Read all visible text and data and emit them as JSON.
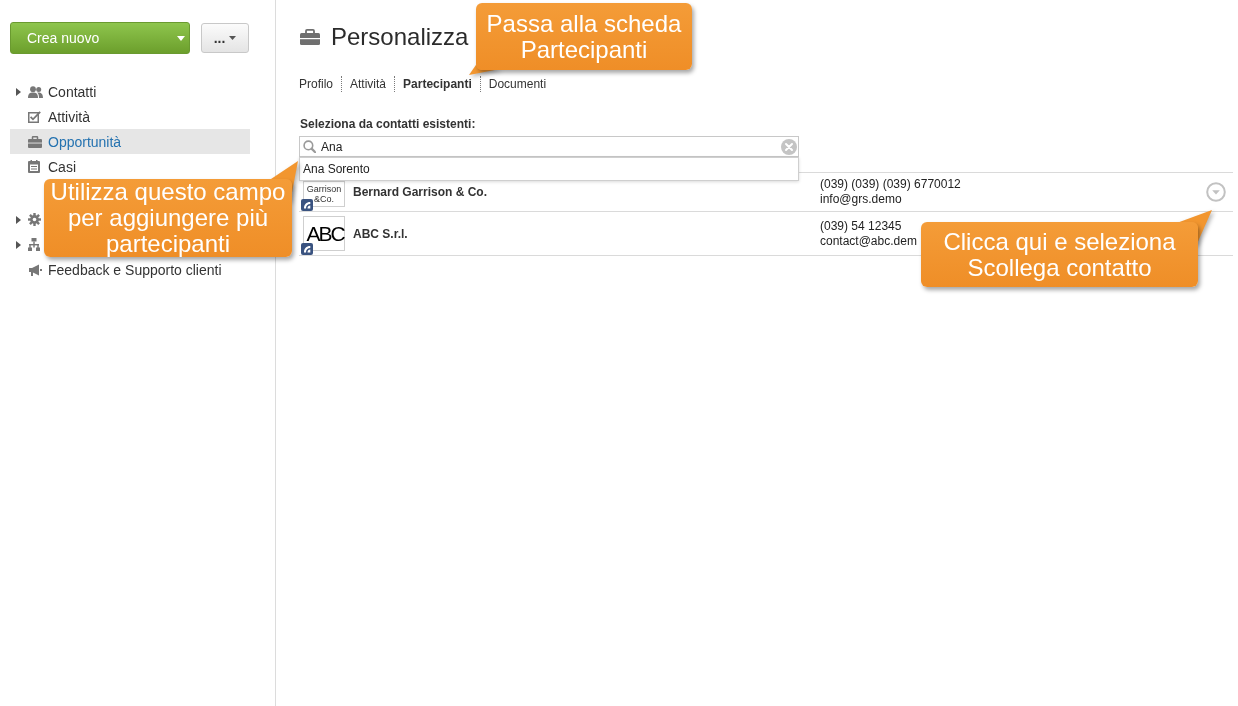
{
  "sidebar": {
    "create_button": {
      "label": "Crea nuovo"
    },
    "more_button": {
      "label": "..."
    },
    "groups": [
      {
        "items": [
          {
            "label": "Contatti",
            "expandable": true,
            "selected": false
          },
          {
            "label": "Attività",
            "expandable": false,
            "selected": false
          },
          {
            "label": "Opportunità",
            "expandable": false,
            "selected": true
          },
          {
            "label": "Casi",
            "expandable": false,
            "selected": false
          }
        ]
      },
      {
        "items": [
          {
            "expandable": true,
            "selected": false
          },
          {
            "expandable": true,
            "selected": false
          },
          {
            "label": "Feedback e Supporto clienti",
            "expandable": false,
            "selected": false
          }
        ]
      }
    ]
  },
  "page": {
    "title": "Personalizza"
  },
  "tabs": [
    {
      "label": "Profilo",
      "selected": false
    },
    {
      "label": "Attività",
      "selected": false
    },
    {
      "label": "Partecipanti",
      "selected": true
    },
    {
      "label": "Documenti",
      "selected": false
    }
  ],
  "participants": {
    "label": "Seleziona da contatti esistenti:",
    "search": {
      "value": "Ana"
    },
    "suggestions": [
      "Ana Sorento"
    ],
    "rows": [
      {
        "logo_text": "Garrison &Co.",
        "name": "Bernard Garrison & Co.",
        "phone": "(039) (039) (039) 6770012",
        "email": "info@grs.demo",
        "hovered": true
      },
      {
        "logo_text": "ABC",
        "name": "ABC S.r.l.",
        "phone": "(039) 54 12345",
        "email": "contact@abc.dem",
        "hovered": false
      }
    ]
  },
  "callouts": [
    {
      "text": "Passa alla scheda Partecipanti"
    },
    {
      "text": "Utilizza questo campo per aggiungere più partecipanti"
    },
    {
      "text": "Clicca qui e seleziona Scollega contatto"
    }
  ]
}
